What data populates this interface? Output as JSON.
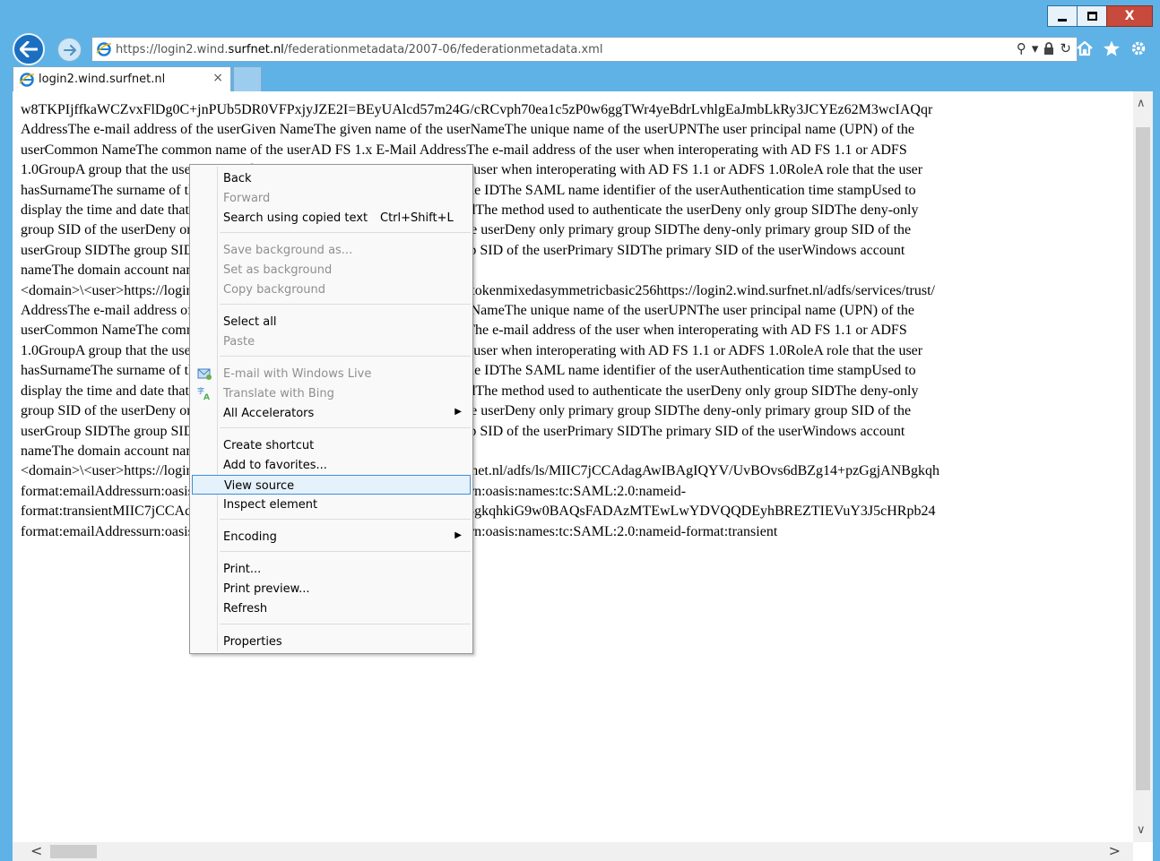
{
  "window": {
    "minimize_glyph": "minimize-icon",
    "maximize_glyph": "maximize-icon",
    "close_label": "X"
  },
  "address_bar": {
    "url_prefix": "https://login2.wind.",
    "url_host": "surfnet.nl",
    "url_path": "/federationmetadata/2007-06/federationmetadata.xml",
    "search_glyph": "⚲",
    "dropdown_glyph": "▾",
    "lock_glyph": "🔒",
    "refresh_glyph": "↻"
  },
  "tab": {
    "title": "login2.wind.surfnet.nl",
    "close_glyph": "×"
  },
  "document": {
    "lines": [
      "w8TKPIjffkaWCZvxFlDg0C+jnPUb5DR0VFPxjyJZE2I=BEyUAlcd57m24G/cRCvph70ea1c5zP0w6ggTWr4yeBdrLvhlgEaJmbLkRy3JCYEz62M3wcIAQqr",
      "AddressThe e-mail address of the userGiven NameThe given name of the userNameThe unique name of the userUPNThe user principal name (UPN) of the",
      "userCommon NameThe common name of the userAD FS 1.x E-Mail AddressThe e-mail address of the user when interoperating with AD FS 1.1 or ADFS",
      "1.0GroupA group that the user is a member ofAD FS 1.x UPNThe UPN of the user when interoperating with AD FS 1.1 or ADFS 1.0RoleA role that the user",
      "hasSurnameThe surname of the userPPIDThe private identifier of the userName IDThe SAML name identifier of the userAuthentication time stampUsed to",
      "display the time and date that the user was authenticatedAuthentication methodThe method used to authenticate the userDeny only group SIDThe deny-only",
      "group SID of the userDeny only primary SIDThe deny-only primary SID of the userDeny only primary group SIDThe deny-only primary group SID of the",
      "userGroup SIDThe group SID of the userPrimary group SIDThe primary group SID of the userPrimary SIDThe primary SID of the userWindows account",
      "nameThe domain account name of the user in the form of",
      "<domain>\\<user>https://login2.wind.surfnet.nl/adfs/services/trust/2005/issuedtokenmixedasymmetricbasic256https://login2.wind.surfnet.nl/adfs/services/trust/",
      "AddressThe e-mail address of the userGiven NameThe given name of the userNameThe unique name of the userUPNThe user principal name (UPN) of the",
      "userCommon NameThe common name of the userAD FS 1.x E-Mail AddressThe e-mail address of the user when interoperating with AD FS 1.1 or ADFS",
      "1.0GroupA group that the user is a member ofAD FS 1.x UPNThe UPN of the user when interoperating with AD FS 1.1 or ADFS 1.0RoleA role that the user",
      "hasSurnameThe surname of the userPPIDThe private identifier of the userName IDThe SAML name identifier of the userAuthentication time stampUsed to",
      "display the time and date that the user was authenticatedAuthentication methodThe method used to authenticate the userDeny only group SIDThe deny-only",
      "group SID of the userDeny only primary SIDThe deny-only primary SID of the userDeny only primary group SIDThe deny-only primary group SID of the",
      "userGroup SIDThe group SID of the userPrimary group SIDThe primary group SID of the userPrimary SIDThe primary SID of the userWindows account",
      "nameThe domain account name of the user in the form of",
      "<domain>\\<user>https://login2.wind.surfnet.nl/adfs/ls/https://login2.wind.surfnet.nl/adfs/ls/MIIC7jCCAdagAwIBAgIQYV/UvBOvs6dBZg14+pzGgjANBgkqh",
      "format:emailAddressurn:oasis:names:tc:SAML:2.0:nameid-format:persistenturn:oasis:names:tc:SAML:2.0:nameid-",
      "format:transientMIIC7jCCAdagAwIBAgIQYV/UvBOvs6dBZg14+pzGgjANBgkqhkiG9w0BAQsFADAzMTEwLwYDVQQDEyhBREZTIEVuY3J5cHRpb24",
      "format:emailAddressurn:oasis:names:tc:SAML:2.0:nameid-format:persistenturn:oasis:names:tc:SAML:2.0:nameid-format:transient"
    ]
  },
  "context_menu": {
    "back": "Back",
    "forward": "Forward",
    "search_copied": "Search using copied text",
    "search_copied_shortcut": "Ctrl+Shift+L",
    "save_background": "Save background as...",
    "set_background": "Set as background",
    "copy_background": "Copy background",
    "select_all": "Select all",
    "paste": "Paste",
    "email_live": "E-mail with Windows Live",
    "translate_bing": "Translate with Bing",
    "all_accelerators": "All Accelerators",
    "create_shortcut": "Create shortcut",
    "add_favorites": "Add to favorites...",
    "view_source": "View source",
    "inspect_element": "Inspect element",
    "encoding": "Encoding",
    "print": "Print...",
    "print_preview": "Print preview...",
    "refresh": "Refresh",
    "properties": "Properties",
    "submenu_arrow": "▶"
  },
  "scrollbars": {
    "up_glyph": "∧",
    "down_glyph": "∨",
    "left_glyph": "<",
    "right_glyph": ">"
  },
  "colors": {
    "frame": "#5fb2e6",
    "accent": "#1b6fc0",
    "menu_highlight": "#e5f1fb",
    "close_button": "#c74a3c"
  }
}
